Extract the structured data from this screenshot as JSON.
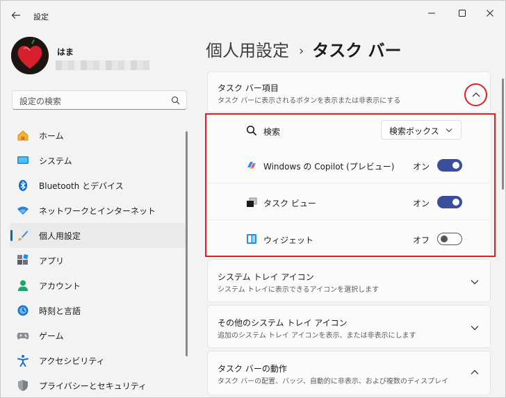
{
  "window": {
    "title": "設定",
    "controls": {
      "minimize": "−",
      "maximize": "☐",
      "close": "✕"
    }
  },
  "profile": {
    "name": "はま"
  },
  "search": {
    "placeholder": "設定の検索"
  },
  "nav": {
    "items": [
      {
        "label": "ホーム",
        "icon": "home-icon"
      },
      {
        "label": "システム",
        "icon": "system-icon"
      },
      {
        "label": "Bluetooth とデバイス",
        "icon": "bluetooth-icon"
      },
      {
        "label": "ネットワークとインターネット",
        "icon": "network-icon"
      },
      {
        "label": "個人用設定",
        "icon": "personalization-icon",
        "active": true
      },
      {
        "label": "アプリ",
        "icon": "apps-icon"
      },
      {
        "label": "アカウント",
        "icon": "account-icon"
      },
      {
        "label": "時刻と言語",
        "icon": "time-language-icon"
      },
      {
        "label": "ゲーム",
        "icon": "gaming-icon"
      },
      {
        "label": "アクセシビリティ",
        "icon": "accessibility-icon"
      },
      {
        "label": "プライバシーとセキュリティ",
        "icon": "privacy-shield-icon"
      }
    ]
  },
  "breadcrumb": {
    "parent": "個人用設定",
    "separator": "›",
    "current": "タスク バー"
  },
  "taskbar_items": {
    "title": "タスク バー項目",
    "subtitle": "タスク バーに表示されるボタンを表示または非表示にする",
    "rows": [
      {
        "label": "検索",
        "icon": "search-icon",
        "dropdown_value": "検索ボックス"
      },
      {
        "label": "Windows の Copilot (プレビュー)",
        "icon": "copilot-icon",
        "state": "オン",
        "on": true
      },
      {
        "label": "タスク ビュー",
        "icon": "task-view-icon",
        "state": "オン",
        "on": true
      },
      {
        "label": "ウィジェット",
        "icon": "widgets-icon",
        "state": "オフ",
        "on": false
      }
    ]
  },
  "sections": [
    {
      "title": "システム トレイ アイコン",
      "subtitle": "システム トレイに表示できるアイコンを選択します"
    },
    {
      "title": "その他のシステム トレイ アイコン",
      "subtitle": "追加のシステム トレイ アイコンを表示、または非表示にします"
    },
    {
      "title": "タスク バーの動作",
      "subtitle": "タスク バーの配置、バッジ、自動的に非表示、および複数のディスプレイ"
    }
  ],
  "colors": {
    "accent": "#0067c0",
    "toggle_on": "#3b4e9c",
    "highlight": "#e0201f"
  }
}
